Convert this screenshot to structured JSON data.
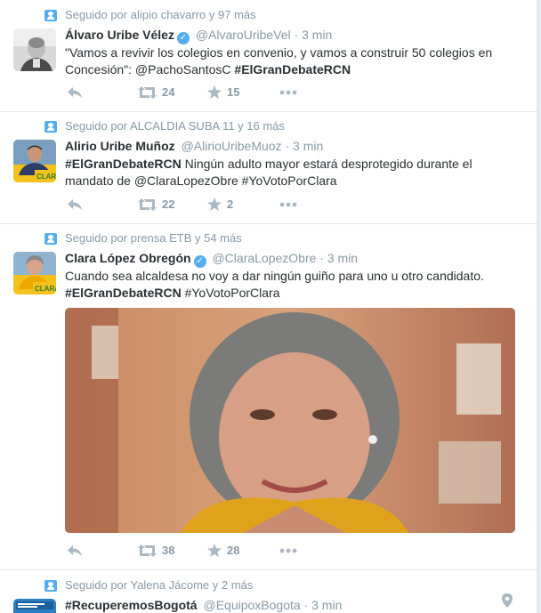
{
  "tweets": [
    {
      "context": "Seguido por alipio chavarro y 97 más",
      "fullname": "Álvaro Uribe Vélez",
      "verified": true,
      "username": "@AlvaroUribeVel",
      "dot": "·",
      "time": "3 min",
      "text_parts": [
        "\"Vamos a revivir los colegios en convenio, y vamos a construir 50 colegios en Concesión\": @PachoSantosC ",
        "#ElGranDebateRCN"
      ],
      "retweets": "24",
      "likes": "15"
    },
    {
      "context": "Seguido por ALCALDIA SUBA 11 y 16 más",
      "fullname": "Alirio Uribe Muñoz",
      "verified": false,
      "username": "@AlirioUribeMuoz",
      "dot": "·",
      "time": "3 min",
      "text_parts": [
        "#ElGranDebateRCN",
        " Ningún adulto mayor estará desprotegido durante el mandato de @ClaraLopezObre #YoVotoPorClara"
      ],
      "retweets": "22",
      "likes": "2"
    },
    {
      "context": "Seguido por prensa ETB y 54 más",
      "fullname": "Clara López Obregón",
      "verified": true,
      "username": "@ClaraLopezObre",
      "dot": "·",
      "time": "3 min",
      "text_parts": [
        "Cuando sea alcaldesa no voy a dar ningún guiño para uno u otro candidato.",
        "#ElGranDebateRCN",
        " #YoVotoPorClara"
      ],
      "retweets": "38",
      "likes": "28"
    },
    {
      "context": "Seguido por Yalena Jácome y 2 más",
      "fullname": "#RecuperemosBogotá",
      "verified": false,
      "username": "@EquipoxBogota",
      "dot": "·",
      "time": "3 min"
    }
  ],
  "icons": {
    "reply": "reply-icon",
    "retweet": "retweet-icon",
    "like": "star-icon",
    "more": "more-icon",
    "context": "person-icon",
    "location": "location-pin-icon"
  },
  "colors": {
    "accent": "#55acee",
    "muted": "#8899a6",
    "text": "#292f33",
    "border": "#e1e8ed"
  }
}
